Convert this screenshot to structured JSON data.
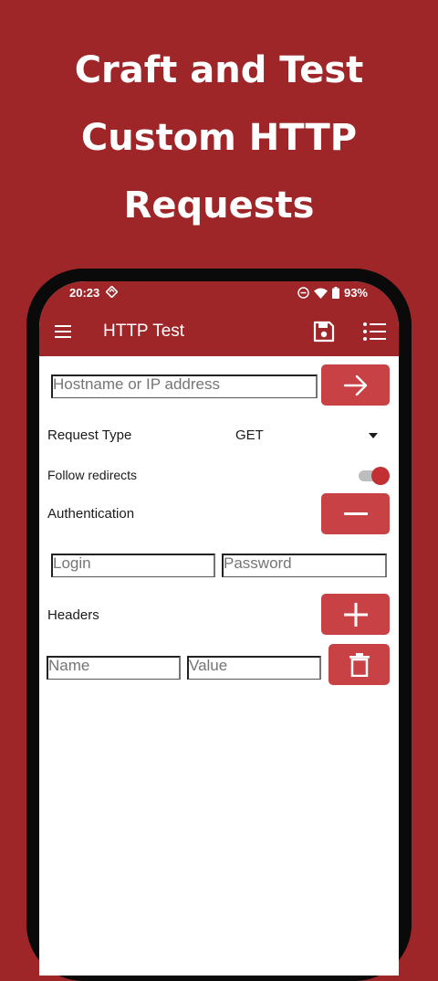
{
  "promo": {
    "line1": "Craft and Test",
    "line2": "Custom HTTP",
    "line3": "Requests"
  },
  "status_bar": {
    "time": "20:23",
    "battery": "93%"
  },
  "app_bar": {
    "title": "HTTP Test"
  },
  "form": {
    "host_placeholder": "Hostname or IP address",
    "request_type_label": "Request Type",
    "request_type_value": "GET",
    "follow_redirects_label": "Follow redirects",
    "follow_redirects_on": true,
    "authentication_label": "Authentication",
    "login_placeholder": "Login",
    "password_placeholder": "Password",
    "headers_label": "Headers",
    "header_name_placeholder": "Name",
    "header_value_placeholder": "Value"
  },
  "colors": {
    "brand": "#9e2628",
    "button": "#c84145",
    "toggle_thumb": "#c23034"
  },
  "icons": {
    "menu": "menu-icon",
    "save": "save-icon",
    "list": "list-icon",
    "go": "arrow-right-icon",
    "remove": "minus-icon",
    "add": "plus-icon",
    "delete": "trash-icon"
  }
}
